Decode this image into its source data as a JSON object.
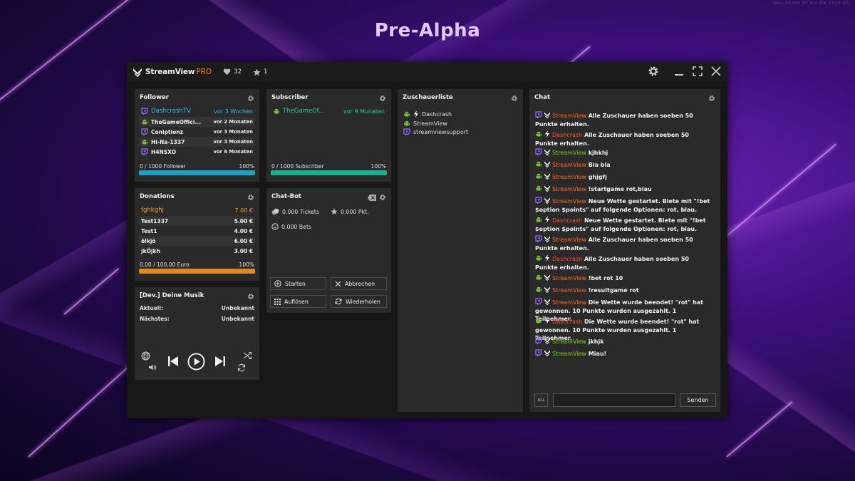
{
  "page_title": "Pre-Alpha",
  "watermark": "WALLPAPER BY NICIEN STUDIOS",
  "app": {
    "name": "StreamView",
    "edition": "PRO",
    "likes": "32",
    "stars": "1"
  },
  "follower": {
    "title": "Follower",
    "highlight": {
      "name": "DashcrashTV",
      "time": "vor 3 Wochen",
      "color": "#3bb8e8"
    },
    "items": [
      {
        "name": "TheGameOffici...",
        "time": "vor 2 Monaten",
        "icon": "android-icon"
      },
      {
        "name": "Coniptionz",
        "time": "vor 3 Monaten",
        "icon": "twitch-icon"
      },
      {
        "name": "Hi-Na-1337",
        "time": "vor 3 Monaten",
        "icon": "android-icon"
      },
      {
        "name": "H4NSXO",
        "time": "vor 6 Monaten",
        "icon": "twitch-icon"
      }
    ],
    "progress_label": "0 / 1000 Follower",
    "progress_pct": "100%",
    "progress": 1.0,
    "bar_color": "#1aa1c4"
  },
  "subscriber": {
    "title": "Subscriber",
    "highlight": {
      "name": "TheGameOf...",
      "time": "vor 9 Monaten",
      "color": "#2ec4a0"
    },
    "progress_label": "0 / 1000 Subscriber",
    "progress_pct": "100%",
    "progress": 1.0,
    "bar_color": "#1bb28f"
  },
  "viewers": {
    "title": "Zuschauerliste",
    "items": [
      {
        "name": "Dashcrash",
        "icons": [
          "android-icon",
          "lightning-icon"
        ]
      },
      {
        "name": "StreamView",
        "icons": [
          "android-icon"
        ]
      },
      {
        "name": "streamviewsupport",
        "icons": [
          "twitch-icon"
        ]
      }
    ]
  },
  "donations": {
    "title": "Donations",
    "highlight": {
      "name": "fghkghj",
      "amount": "7.00 €",
      "color": "#f09a2a"
    },
    "items": [
      {
        "name": "Test1337",
        "amount": "5.00 €"
      },
      {
        "name": "Test1",
        "amount": "4.00 €"
      },
      {
        "name": "ölkjö",
        "amount": "6.00 €"
      },
      {
        "name": "jkÖjkh",
        "amount": "3.00 €"
      }
    ],
    "progress_label": "0,00 / 100,00 Euro",
    "progress_pct": "100%",
    "progress": 1.0,
    "bar_color": "#e08a1e"
  },
  "chatbot": {
    "title": "Chat-Bot",
    "tickets": "0.000 Tickets",
    "points": "0.000 Pkt.",
    "bets": "0.000 Bets",
    "buttons": {
      "start": "Starten",
      "cancel": "Abbrechen",
      "resolve": "Auflösen",
      "repeat": "Wiederholen"
    }
  },
  "music": {
    "title": "[Dev.] Deine Musik",
    "current_label": "Aktuell:",
    "current_value": "Unbekannt",
    "next_label": "Nächstes:",
    "next_value": "Unbekannt"
  },
  "chat": {
    "title": "Chat",
    "all_label": "ALL",
    "send_label": "Senden",
    "messages": [
      {
        "platform": "twitch-icon",
        "badge": "streamview-icon",
        "user": "StreamView",
        "user_color": "#ff6a1f",
        "text": "Alle Zuschauer haben soeben 50 Punkte erhalten."
      },
      {
        "platform": "android-icon",
        "badge": "lightning-icon",
        "user": "Dashcrash",
        "user_color": "#ff4f3a",
        "text": "Alle Zuschauer haben soeben 50 Punkte erhalten."
      },
      {
        "platform": "twitch-icon",
        "badge": "streamview-icon",
        "user": "StreamView",
        "user_color": "#7ed321",
        "text": "kjhkhj"
      },
      {
        "platform": "android-icon",
        "badge": "streamview-icon",
        "user": "StreamView",
        "user_color": "#ff6a1f",
        "text": "Bla bla"
      },
      {
        "platform": "android-icon",
        "badge": "streamview-icon",
        "user": "StreamView",
        "user_color": "#ff6a1f",
        "text": "ghjgfj"
      },
      {
        "platform": "android-icon",
        "badge": "streamview-icon",
        "user": "StreamView",
        "user_color": "#ff6a1f",
        "text": "!startgame rot,blau"
      },
      {
        "platform": "twitch-icon",
        "badge": "streamview-icon",
        "user": "StreamView",
        "user_color": "#ff6a1f",
        "text": "Neue Wette gestartet. Biete mit \"!bet $option $points\" auf folgende Optionen: rot, blau."
      },
      {
        "platform": "android-icon",
        "badge": "lightning-icon",
        "user": "Dashcrash",
        "user_color": "#ff4f3a",
        "text": "Neue Wette gestartet. Biete mit \"!bet $option $points\" auf folgende Optionen: rot, blau."
      },
      {
        "platform": "twitch-icon",
        "badge": "streamview-icon",
        "user": "StreamView",
        "user_color": "#ff6a1f",
        "text": "Alle Zuschauer haben soeben 50 Punkte erhalten."
      },
      {
        "platform": "android-icon",
        "badge": "lightning-icon",
        "user": "Dashcrash",
        "user_color": "#ff4f3a",
        "text": "Alle Zuschauer haben soeben 50 Punkte erhalten."
      },
      {
        "platform": "android-icon",
        "badge": "streamview-icon",
        "user": "StreamView",
        "user_color": "#ff6a1f",
        "text": "!bet rot 10"
      },
      {
        "platform": "android-icon",
        "badge": "streamview-icon",
        "user": "StreamView",
        "user_color": "#ff6a1f",
        "text": "!resultgame rot"
      },
      {
        "platform": "twitch-icon",
        "badge": "streamview-icon",
        "user": "StreamView",
        "user_color": "#ff6a1f",
        "text": "Die Wette wurde beendet! \"rot\" hat gewonnen. 10 Punkte wurden ausgezahlt. 1 Teilnehmer."
      },
      {
        "platform": "android-icon",
        "badge": "lightning-icon",
        "user": "Dashcrash",
        "user_color": "#ff4f3a",
        "text": "Die Wette wurde beendet! \"rot\" hat gewonnen. 10 Punkte wurden ausgezahlt. 1 Teilnehmer."
      },
      {
        "platform": "twitch-icon",
        "badge": "streamview-icon",
        "user": "StreamView",
        "user_color": "#7ed321",
        "text": "jkhjk"
      },
      {
        "platform": "twitch-icon",
        "badge": "streamview-icon",
        "user": "StreamView",
        "user_color": "#7ed321",
        "text": "Miau!"
      }
    ]
  },
  "colors": {
    "twitch": "#9b6cff",
    "android": "#7ac143",
    "lightning": "#ffffff",
    "panel": "#2a2a2a",
    "window": "#171717"
  }
}
